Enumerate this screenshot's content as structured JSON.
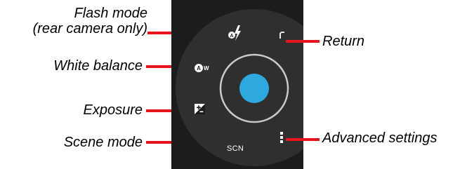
{
  "callouts": {
    "flash_mode_line1": "Flash mode",
    "flash_mode_line2": "(rear camera only)",
    "white_balance": "White balance",
    "exposure": "Exposure",
    "scene_mode": "Scene mode",
    "return": "Return",
    "advanced_settings": "Advanced settings"
  },
  "camera_ui": {
    "scene_button_label": "SCN",
    "shutter_color": "#2da9e0",
    "panel_color": "#1c1c1c",
    "dial_color": "#2f2f2f",
    "icons": [
      "flash-auto-icon",
      "white-balance-auto-icon",
      "exposure-icon",
      "return-icon",
      "more-vert-icon"
    ]
  },
  "colors": {
    "leader_line": "#e8141b",
    "label_text": "#000000"
  }
}
